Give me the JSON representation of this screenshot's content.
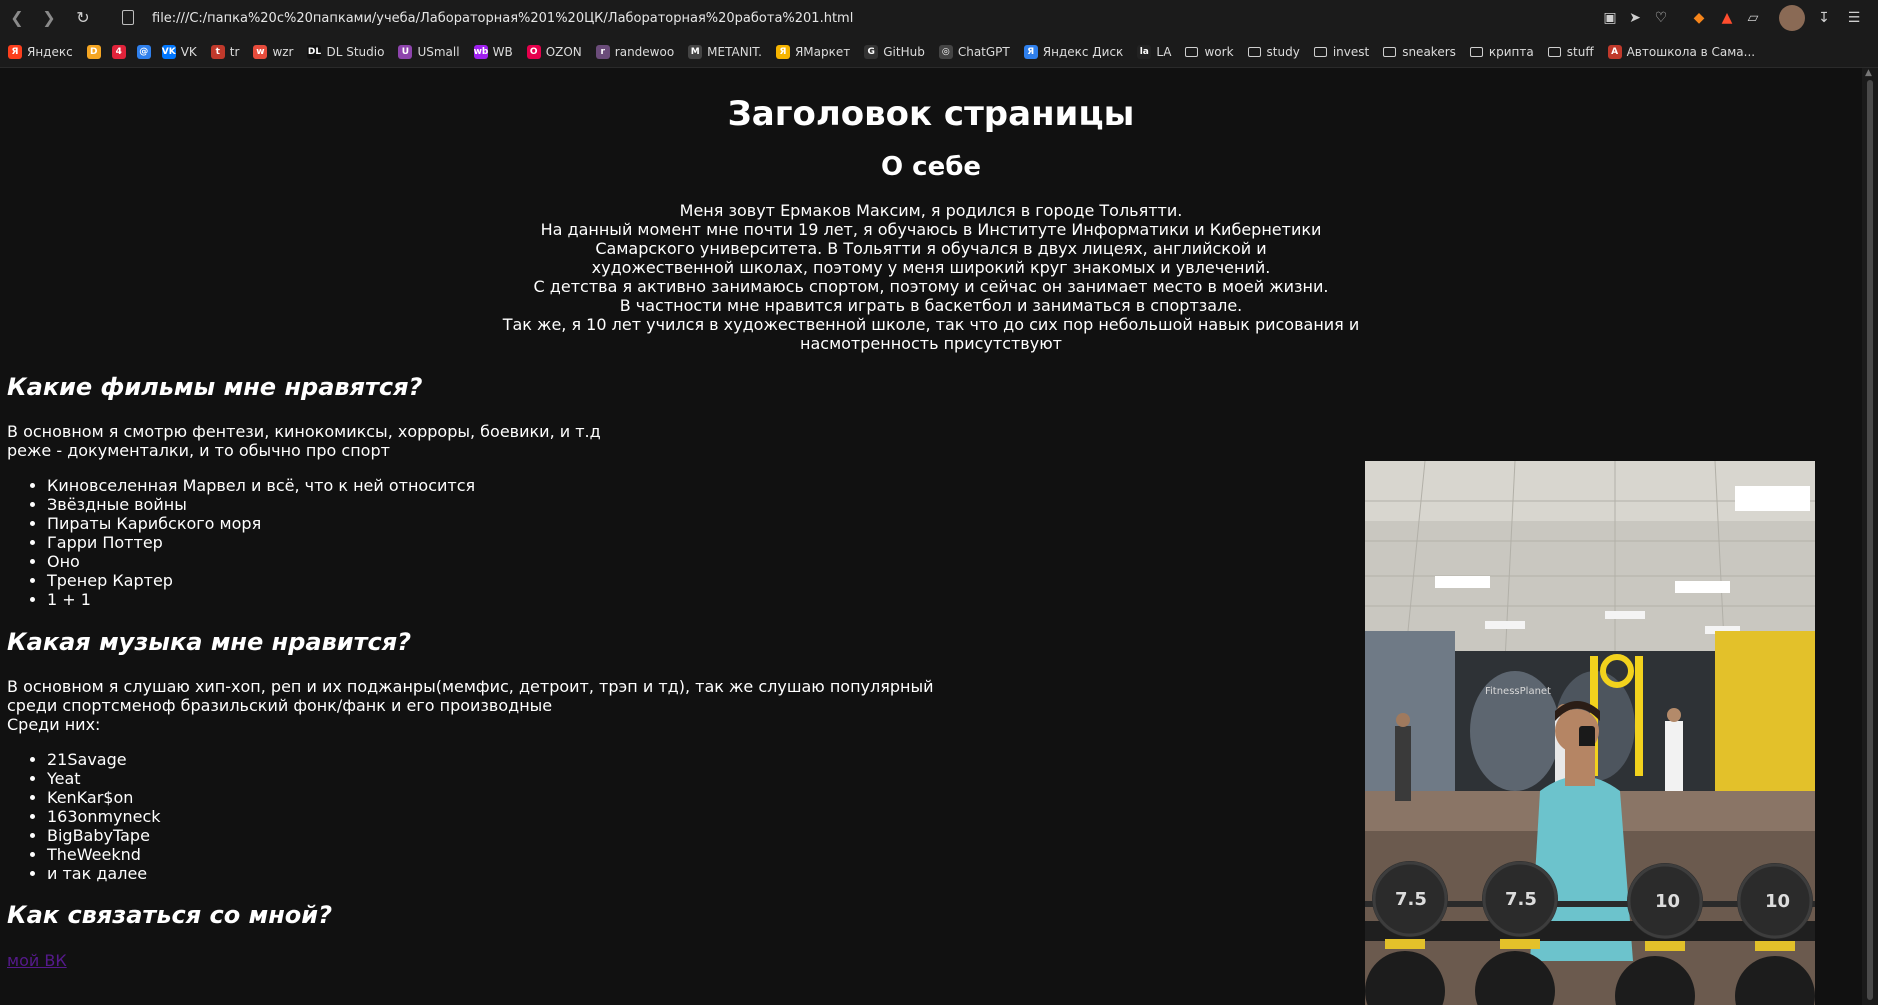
{
  "browser": {
    "url": "file:///C:/папка%20c%20папками/учеба/Лабораторная%201%20ЦК/Лабораторная%20работа%201.html",
    "bookmarks": [
      {
        "label": "Яндекс",
        "color": "#fc3f1d",
        "glyph": "Я",
        "type": "site"
      },
      {
        "label": "",
        "color": "#f5a623",
        "glyph": "D",
        "type": "site"
      },
      {
        "label": "",
        "color": "#e0233a",
        "glyph": "4",
        "type": "site"
      },
      {
        "label": "",
        "color": "#2f80ed",
        "glyph": "@",
        "type": "site"
      },
      {
        "label": "VK",
        "color": "#0077ff",
        "glyph": "VK",
        "type": "site"
      },
      {
        "label": "tr",
        "color": "#c0392b",
        "glyph": "t",
        "type": "site"
      },
      {
        "label": "wzr",
        "color": "#e74c3c",
        "glyph": "w",
        "type": "site"
      },
      {
        "label": "DL Studio",
        "color": "#111111",
        "glyph": "DL",
        "type": "site"
      },
      {
        "label": "USmall",
        "color": "#8e44ad",
        "glyph": "U",
        "type": "site"
      },
      {
        "label": "WB",
        "color": "#a020f0",
        "glyph": "wb",
        "type": "site"
      },
      {
        "label": "OZON",
        "color": "#e6004c",
        "glyph": "O",
        "type": "site"
      },
      {
        "label": "randewoo",
        "color": "#6b4c7a",
        "glyph": "r",
        "type": "site"
      },
      {
        "label": "METANIT.",
        "color": "#444444",
        "glyph": "M",
        "type": "site"
      },
      {
        "label": "ЯМаркет",
        "color": "#f7b500",
        "glyph": "Я",
        "type": "site"
      },
      {
        "label": "GitHub",
        "color": "#333333",
        "glyph": "G",
        "type": "site"
      },
      {
        "label": "ChatGPT",
        "color": "#444444",
        "glyph": "◎",
        "type": "site"
      },
      {
        "label": "Яндекс Диск",
        "color": "#2f80ed",
        "glyph": "Я",
        "type": "site"
      },
      {
        "label": "LA",
        "color": "#222222",
        "glyph": "la",
        "type": "site"
      },
      {
        "label": "work",
        "type": "folder"
      },
      {
        "label": "study",
        "type": "folder"
      },
      {
        "label": "invest",
        "type": "folder"
      },
      {
        "label": "sneakers",
        "type": "folder"
      },
      {
        "label": "крипта",
        "type": "folder"
      },
      {
        "label": "stuff",
        "type": "folder"
      },
      {
        "label": "Автошкола в Сама...",
        "color": "#c0392b",
        "glyph": "A",
        "type": "site"
      }
    ]
  },
  "page": {
    "title": "Заголовок страницы",
    "about_heading": "О себе",
    "about_lines": [
      "Меня зовут Ермаков Максим, я родился в городе Тольятти.",
      "На данный момент мне почти 19 лет, я обучаюсь в Институте Информатики и Кибернетики",
      "Самарского университета. В Тольятти я обучался в двух лицеях, английской и",
      "художественной школах, поэтому у меня широкий круг знакомых и увлечений.",
      "С детства я активно занимаюсь спортом, поэтому и сейчас он занимает место в моей жизни.",
      "В частности мне нравится играть в баскетбол и заниматься в спортзале.",
      "Так же, я 10 лет учился в художественной школе, так что до сих пор небольшой навык рисования и",
      "насмотренность присутствуют"
    ],
    "movies": {
      "heading": "Какие фильмы мне нравятся?",
      "intro_lines": [
        "В основном я смотрю фентези, кинокомиксы, хорроры, боевики, и т.д",
        "реже - документалки, и то обычно про спорт"
      ],
      "items": [
        "Киновселенная Марвел и всё, что к ней относится",
        "Звёздные войны",
        "Пираты Карибского моря",
        "Гарри Поттер",
        "Оно",
        "Тренер Картер",
        "1 + 1"
      ]
    },
    "music": {
      "heading": "Какая музыка мне нравится?",
      "intro_lines": [
        "В основном я слушаю хип-хоп, реп и их поджанры(мемфис, детроит, трэп и тд), так же слушаю популярный",
        "среди спортсменоф бразильский фонк/фанк и его производные",
        "Среди них:"
      ],
      "items": [
        "21Savage",
        "Yeat",
        "KenKar$on",
        "163onmyneck",
        "BigBabyTape",
        "TheWeeknd",
        "и так далее"
      ]
    },
    "contact": {
      "heading": "Как связаться со мной?",
      "link_label": "мой ВК"
    },
    "photo": {
      "gym_sign": "FitnessPlanet",
      "plates": [
        "7.5",
        "7.5",
        "10",
        "10"
      ]
    }
  }
}
